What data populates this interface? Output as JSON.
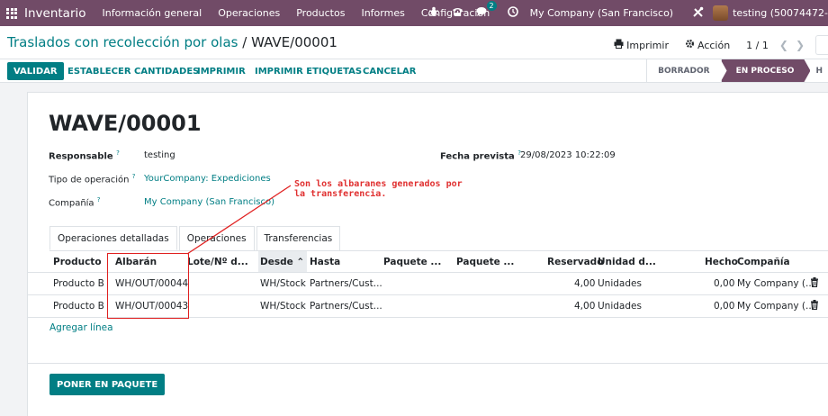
{
  "navbar": {
    "brand": "Inventario",
    "menu": [
      "Información general",
      "Operaciones",
      "Productos",
      "Informes",
      "Configuración"
    ],
    "chat_badge": "2",
    "company": "My Company (San Francisco)",
    "user": "testing (50074472-"
  },
  "control": {
    "breadcrumb_parent": "Traslados con recolección por olas",
    "breadcrumb_sep": "/",
    "breadcrumb_current": "WAVE/00001",
    "print": "Imprimir",
    "action": "Acción",
    "pager": "1 / 1"
  },
  "actions": {
    "validate": "VALIDAR",
    "set_quantities": "ESTABLECER CANTIDADES",
    "print": "IMPRIMIR",
    "print_labels": "IMPRIMIR ETIQUETAS",
    "cancel": "CANCELAR"
  },
  "status": {
    "draft": "BORRADOR",
    "in_progress": "EN PROCESO",
    "done_partial": "H"
  },
  "form": {
    "name": "WAVE/00001",
    "responsible_label": "Responsable",
    "responsible": "testing",
    "operation_type_label": "Tipo de operación",
    "operation_type": "YourCompany: Expediciones",
    "company_label": "Compañía",
    "company": "My Company (San Francisco)",
    "scheduled_label": "Fecha prevista",
    "scheduled": "29/08/2023 10:22:09",
    "help_mark": "?"
  },
  "annotation": "Son los albaranes generados por\nla transferencia.",
  "tabs": [
    "Operaciones detalladas",
    "Operaciones",
    "Transferencias"
  ],
  "table": {
    "headers": [
      "Producto",
      "Albarán",
      "Lote/Nº d...",
      "Desde",
      "Hasta",
      "Paquete ...",
      "Paquete ...",
      "Reservado",
      "Unidad d...",
      "Hecho",
      "Compañía"
    ],
    "rows": [
      [
        "Producto B",
        "WH/OUT/00044",
        "",
        "WH/Stock",
        "Partners/Cust...",
        "",
        "",
        "4,00",
        "Unidades",
        "0,00",
        "My Company (..."
      ],
      [
        "Producto B",
        "WH/OUT/00043",
        "",
        "WH/Stock",
        "Partners/Cust...",
        "",
        "",
        "4,00",
        "Unidades",
        "0,00",
        "My Company (..."
      ]
    ],
    "add_line": "Agregar línea"
  },
  "footer": {
    "put_in_pack": "PONER EN PAQUETE"
  }
}
